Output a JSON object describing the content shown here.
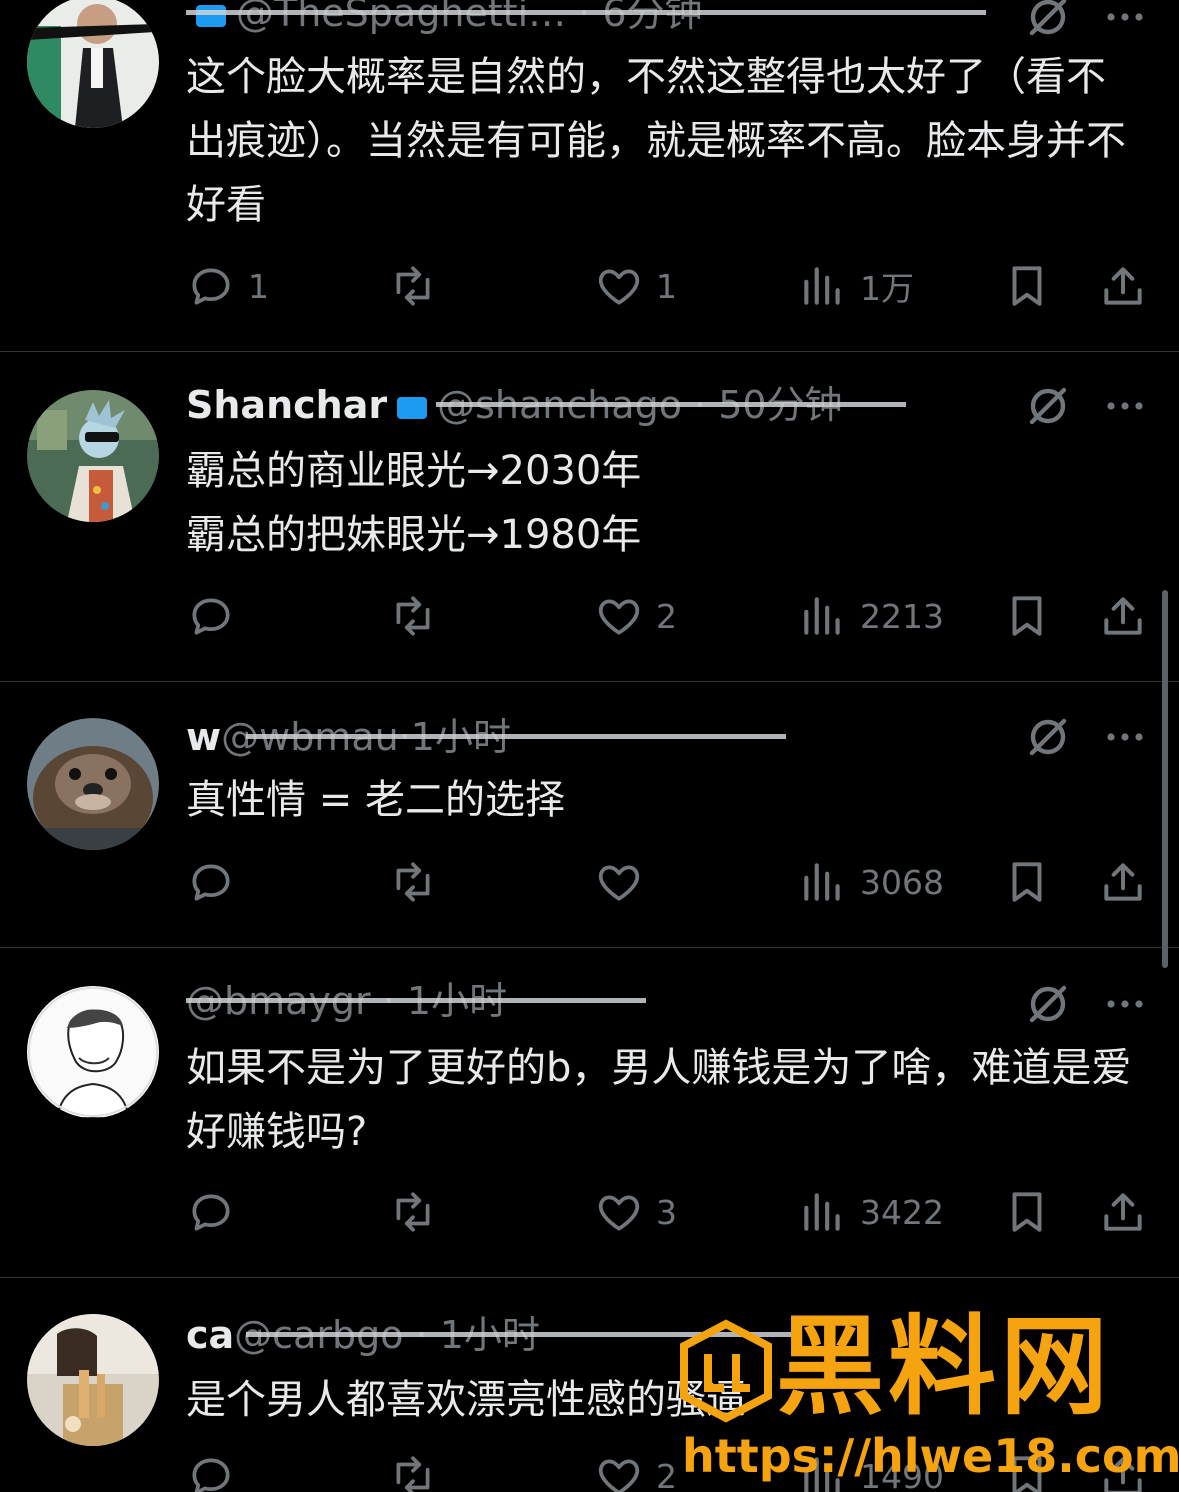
{
  "colors": {
    "background": "#000000",
    "text": "#e7e9ea",
    "secondary": "#71767b",
    "divider": "#2f3336",
    "verified": "#1d9bf0",
    "watermark": "#f5a30f"
  },
  "posts": [
    {
      "header": "@TheSpaghetti… · 6分钟",
      "text": "这个脸大概率是自然的，不然这整得也太好了（看不出痕迹）。当然是有可能，就是概率不高。脸本身并不好看",
      "replies": "1",
      "retweets": "",
      "likes": "1",
      "views": "1万"
    },
    {
      "name": "Shanchar",
      "header": "@shanchago · 50分钟",
      "text": "霸总的商业眼光→2030年\n霸总的把妹眼光→1980年",
      "replies": "",
      "retweets": "",
      "likes": "2",
      "views": "2213"
    },
    {
      "name": "w",
      "header": "@wbmau·1小时",
      "text": "真性情 = 老二的选择",
      "replies": "",
      "retweets": "",
      "likes": "",
      "views": "3068"
    },
    {
      "header": "@bmaygr · 1小时",
      "text": "如果不是为了更好的b，男人赚钱是为了啥，难道是爱好赚钱吗?",
      "replies": "",
      "retweets": "",
      "likes": "3",
      "views": "3422"
    },
    {
      "name": "ca",
      "header": "@carbgo · 1小时",
      "text": "是个男人都喜欢漂亮性感的骚逼",
      "replies": "",
      "retweets": "",
      "likes": "2",
      "views": "1490"
    }
  ],
  "watermark": {
    "title": "黑料网",
    "url": "https://hlwe18.com"
  },
  "icons": [
    "reply-icon",
    "retweet-icon",
    "like-icon",
    "views-icon",
    "bookmark-icon",
    "share-icon",
    "grok-icon",
    "more-icon"
  ]
}
